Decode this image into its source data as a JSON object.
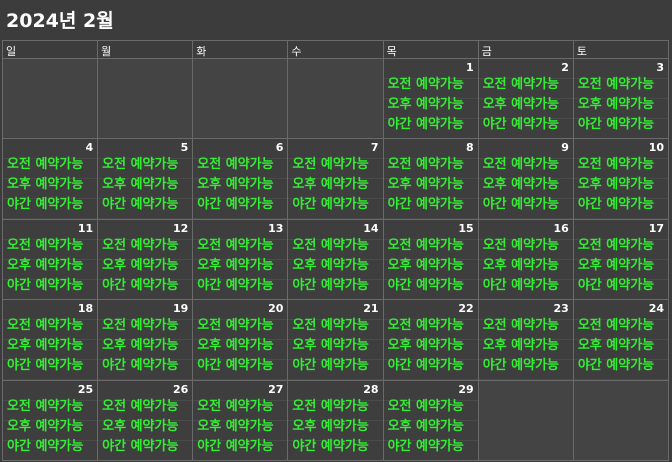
{
  "title": "2024년 2월",
  "weekdays": [
    "일",
    "월",
    "화",
    "수",
    "목",
    "금",
    "토"
  ],
  "slot_labels": [
    "오전 예약가능",
    "오후 예약가능",
    "야간 예약가능"
  ],
  "colors": {
    "available": "#33ee33",
    "background": "#3c3c3c",
    "grid_line": "#6a6a6a"
  },
  "weeks": [
    [
      null,
      null,
      null,
      null,
      "1",
      "2",
      "3"
    ],
    [
      "4",
      "5",
      "6",
      "7",
      "8",
      "9",
      "10"
    ],
    [
      "11",
      "12",
      "13",
      "14",
      "15",
      "16",
      "17"
    ],
    [
      "18",
      "19",
      "20",
      "21",
      "22",
      "23",
      "24"
    ],
    [
      "25",
      "26",
      "27",
      "28",
      "29",
      null,
      null
    ]
  ]
}
